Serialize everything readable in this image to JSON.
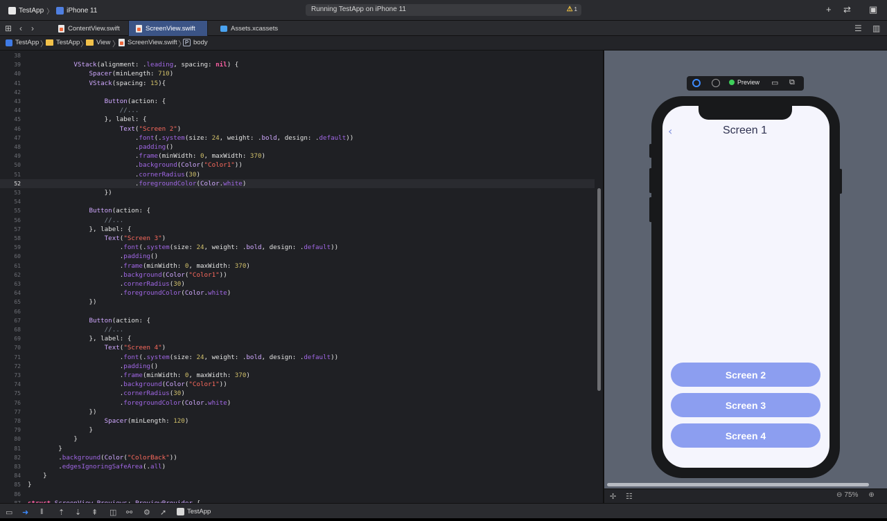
{
  "toolbar": {
    "scheme": "TestApp",
    "device": "iPhone 11",
    "status": "Running TestApp on iPhone 11",
    "warning_count": "1",
    "warning_icon": "⚠",
    "add_icon": "+",
    "swap_icon": "⇄",
    "inspector_icon": "▣"
  },
  "tabs": [
    {
      "label": "ContentView.swift",
      "active": false
    },
    {
      "label": "ScreenView.swift",
      "active": true
    },
    {
      "label": "Assets.xcassets",
      "active": false
    }
  ],
  "breadcrumb": [
    "TestApp",
    "TestApp",
    "View",
    "ScreenView.swift",
    "body"
  ],
  "editor": {
    "current_line": 52,
    "lines": [
      {
        "n": "38",
        "html": ""
      },
      {
        "n": "39",
        "html": "            <span class='ty'>VStack</span>(alignment: .<span class='fn'>leading</span>, spacing: <span class='kw'>nil</span>) {"
      },
      {
        "n": "40",
        "html": "                <span class='ty'>Spacer</span>(minLength: <span class='num'>710</span>)"
      },
      {
        "n": "41",
        "html": "                <span class='ty'>VStack</span>(spacing: <span class='num'>15</span>){"
      },
      {
        "n": "42",
        "html": ""
      },
      {
        "n": "43",
        "html": "                    <span class='ty'>Button</span>(action: {"
      },
      {
        "n": "44",
        "html": "                        <span class='cm'>//...</span>"
      },
      {
        "n": "45",
        "html": "                    }, label: {"
      },
      {
        "n": "46",
        "html": "                        <span class='ty'>Text</span>(<span class='str'>\"Screen 2\"</span>)"
      },
      {
        "n": "47",
        "html": "                            .<span class='fn'>font</span>(.<span class='fn'>system</span>(size: <span class='num'>24</span>, weight: .<span class='ty'>bold</span>, design: .<span class='fn'>default</span>))"
      },
      {
        "n": "48",
        "html": "                            .<span class='fn'>padding</span>()"
      },
      {
        "n": "49",
        "html": "                            .<span class='fn'>frame</span>(minWidth: <span class='num'>0</span>, maxWidth: <span class='num'>370</span>)"
      },
      {
        "n": "50",
        "html": "                            .<span class='fn'>background</span>(<span class='ty'>Color</span>(<span class='str'>\"Color1\"</span>))"
      },
      {
        "n": "51",
        "html": "                            .<span class='fn'>cornerRadius</span>(<span class='num'>30</span>)"
      },
      {
        "n": "52",
        "html": "                            .<span class='fn'>foregroundColor</span>(<span class='ty'>Color</span>.<span class='fn'>white</span>)"
      },
      {
        "n": "53",
        "html": "                    })"
      },
      {
        "n": "54",
        "html": ""
      },
      {
        "n": "55",
        "html": "                <span class='ty'>Button</span>(action: {"
      },
      {
        "n": "56",
        "html": "                    <span class='cm'>//...</span>"
      },
      {
        "n": "57",
        "html": "                }, label: {"
      },
      {
        "n": "58",
        "html": "                    <span class='ty'>Text</span>(<span class='str'>\"Screen 3\"</span>)"
      },
      {
        "n": "59",
        "html": "                        .<span class='fn'>font</span>(.<span class='fn'>system</span>(size: <span class='num'>24</span>, weight: .<span class='ty'>bold</span>, design: .<span class='fn'>default</span>))"
      },
      {
        "n": "60",
        "html": "                        .<span class='fn'>padding</span>()"
      },
      {
        "n": "61",
        "html": "                        .<span class='fn'>frame</span>(minWidth: <span class='num'>0</span>, maxWidth: <span class='num'>370</span>)"
      },
      {
        "n": "62",
        "html": "                        .<span class='fn'>background</span>(<span class='ty'>Color</span>(<span class='str'>\"Color1\"</span>))"
      },
      {
        "n": "63",
        "html": "                        .<span class='fn'>cornerRadius</span>(<span class='num'>30</span>)"
      },
      {
        "n": "64",
        "html": "                        .<span class='fn'>foregroundColor</span>(<span class='ty'>Color</span>.<span class='fn'>white</span>)"
      },
      {
        "n": "65",
        "html": "                })"
      },
      {
        "n": "66",
        "html": ""
      },
      {
        "n": "67",
        "html": "                <span class='ty'>Button</span>(action: {"
      },
      {
        "n": "68",
        "html": "                    <span class='cm'>//...</span>"
      },
      {
        "n": "69",
        "html": "                }, label: {"
      },
      {
        "n": "70",
        "html": "                    <span class='ty'>Text</span>(<span class='str'>\"Screen 4\"</span>)"
      },
      {
        "n": "71",
        "html": "                        .<span class='fn'>font</span>(.<span class='fn'>system</span>(size: <span class='num'>24</span>, weight: .<span class='ty'>bold</span>, design: .<span class='fn'>default</span>))"
      },
      {
        "n": "72",
        "html": "                        .<span class='fn'>padding</span>()"
      },
      {
        "n": "73",
        "html": "                        .<span class='fn'>frame</span>(minWidth: <span class='num'>0</span>, maxWidth: <span class='num'>370</span>)"
      },
      {
        "n": "74",
        "html": "                        .<span class='fn'>background</span>(<span class='ty'>Color</span>(<span class='str'>\"Color1\"</span>))"
      },
      {
        "n": "75",
        "html": "                        .<span class='fn'>cornerRadius</span>(<span class='num'>30</span>)"
      },
      {
        "n": "76",
        "html": "                        .<span class='fn'>foregroundColor</span>(<span class='ty'>Color</span>.<span class='fn'>white</span>)"
      },
      {
        "n": "77",
        "html": "                })"
      },
      {
        "n": "78",
        "html": "                    <span class='ty'>Spacer</span>(minLength: <span class='num'>120</span>)"
      },
      {
        "n": "79",
        "html": "                }"
      },
      {
        "n": "80",
        "html": "            }"
      },
      {
        "n": "81",
        "html": "        }"
      },
      {
        "n": "82",
        "html": "        .<span class='fn'>background</span>(<span class='ty'>Color</span>(<span class='str'>\"ColorBack\"</span>))"
      },
      {
        "n": "83",
        "html": "        .<span class='fn'>edgesIgnoringSafeArea</span>(.<span class='fn'>all</span>)"
      },
      {
        "n": "84",
        "html": "    }"
      },
      {
        "n": "85",
        "html": "}"
      },
      {
        "n": "86",
        "html": ""
      },
      {
        "n": "87",
        "html": "<span class='kw'>struct</span> <span class='ty'>ScreenView_Previews</span>: <span class='ty'>PreviewProvider</span> {"
      }
    ]
  },
  "preview": {
    "toolbar_label": "Preview",
    "screen_title": "Screen 1",
    "back_glyph": "‹",
    "buttons": [
      "Screen 2",
      "Screen 3",
      "Screen 4"
    ],
    "zoom": "75%",
    "zoom_out_glyph": "⊖",
    "zoom_in_glyph": "⊕",
    "button_color": "#8c9ef0",
    "screen_bg": "#f5f5fd"
  },
  "debugbar": {
    "app": "TestApp"
  }
}
